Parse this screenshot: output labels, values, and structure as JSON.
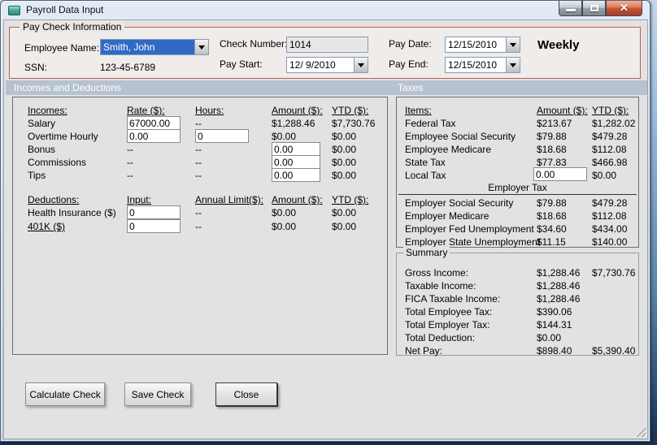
{
  "window": {
    "title": "Payroll Data Input"
  },
  "paycheck": {
    "group_label": "Pay Check Information",
    "employee_name": {
      "label": "Employee Name:",
      "value": "Smith, John"
    },
    "ssn": {
      "label": "SSN:",
      "value": "123-45-6789"
    },
    "check_number": {
      "label": "Check Number:",
      "value": "1014"
    },
    "pay_start": {
      "label": "Pay Start:",
      "value": "12/ 9/2010"
    },
    "pay_date": {
      "label": "Pay Date:",
      "value": "12/15/2010"
    },
    "pay_end": {
      "label": "Pay End:",
      "value": "12/15/2010"
    },
    "frequency": "Weekly"
  },
  "section_headers": {
    "left": "Incomes and Deductions",
    "right": "Taxes"
  },
  "incomes": {
    "headers": {
      "item": "Incomes:",
      "rate": "Rate ($):",
      "hours": "Hours:",
      "amount": "Amount ($):",
      "ytd": "YTD ($):"
    },
    "rows": [
      {
        "label": "Salary",
        "rate": "67000.00",
        "hours": "--",
        "amount": "$1,288.46",
        "ytd": "$7,730.76"
      },
      {
        "label": "Overtime Hourly",
        "rate": "0.00",
        "hours": "0",
        "amount": "$0.00",
        "ytd": "$0.00"
      },
      {
        "label": "Bonus",
        "rate": "--",
        "hours": "--",
        "amount": "0.00",
        "ytd": "$0.00"
      },
      {
        "label": "Commissions",
        "rate": "--",
        "hours": "--",
        "amount": "0.00",
        "ytd": "$0.00"
      },
      {
        "label": "Tips",
        "rate": "--",
        "hours": "--",
        "amount": "0.00",
        "ytd": "$0.00"
      }
    ]
  },
  "deductions": {
    "headers": {
      "item": "Deductions:",
      "input": "Input:",
      "limit": "Annual Limit($):",
      "amount": "Amount ($):",
      "ytd": "YTD ($):"
    },
    "rows": [
      {
        "label": "Health Insurance ($)",
        "input": "0",
        "limit": "--",
        "amount": "$0.00",
        "ytd": "$0.00"
      },
      {
        "label": "401K ($)",
        "input": "0",
        "limit": "--",
        "amount": "$0.00",
        "ytd": "$0.00"
      }
    ]
  },
  "taxes": {
    "headers": {
      "item": "Items:",
      "amount": "Amount ($):",
      "ytd": "YTD ($):"
    },
    "employee_rows": [
      {
        "label": "Federal Tax",
        "amount": "$213.67",
        "ytd": "$1,282.02"
      },
      {
        "label": "Employee Social Security",
        "amount": "$79.88",
        "ytd": "$479.28"
      },
      {
        "label": "Employee Medicare",
        "amount": "$18.68",
        "ytd": "$112.08"
      },
      {
        "label": "State Tax",
        "amount": "$77.83",
        "ytd": "$466.98"
      },
      {
        "label": "Local Tax",
        "amount": "0.00",
        "ytd": "$0.00"
      }
    ],
    "employer_label": "Employer Tax",
    "employer_rows": [
      {
        "label": "Employer Social Security",
        "amount": "$79.88",
        "ytd": "$479.28"
      },
      {
        "label": "Employer Medicare",
        "amount": "$18.68",
        "ytd": "$112.08"
      },
      {
        "label": "Employer Fed Unemployment",
        "amount": "$34.60",
        "ytd": "$434.00"
      },
      {
        "label": "Employer State Unemployment",
        "amount": "$11.15",
        "ytd": "$140.00"
      }
    ]
  },
  "summary": {
    "group_label": "Summary",
    "rows": [
      {
        "label": "Gross Income:",
        "amount": "$1,288.46",
        "ytd": "$7,730.76"
      },
      {
        "label": "Taxable Income:",
        "amount": "$1,288.46",
        "ytd": ""
      },
      {
        "label": "FICA Taxable Income:",
        "amount": "$1,288.46",
        "ytd": ""
      },
      {
        "label": "Total Employee Tax:",
        "amount": "$390.06",
        "ytd": ""
      },
      {
        "label": "Total Employer Tax:",
        "amount": "$144.31",
        "ytd": ""
      },
      {
        "label": "Total Deduction:",
        "amount": "$0.00",
        "ytd": ""
      },
      {
        "label": "Net Pay:",
        "amount": "$898.40",
        "ytd": "$5,390.40"
      }
    ]
  },
  "buttons": {
    "calculate": "Calculate Check",
    "save": "Save Check",
    "close": "Close"
  },
  "colors": {
    "selection_blue": "#316ac5",
    "group_border_red": "#bf5b57",
    "section_header_bg": "#b6c2d1",
    "close_button_red": "#c9553a"
  }
}
